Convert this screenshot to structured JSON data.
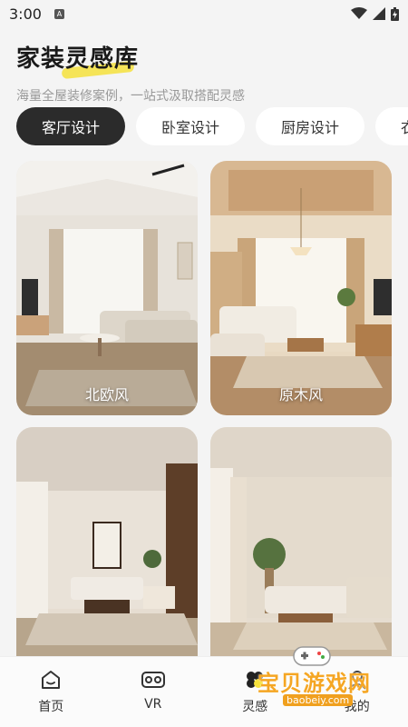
{
  "status": {
    "time": "3:00"
  },
  "header": {
    "title": "家装灵感库",
    "subtitle": "海量全屋装修案例，一站式汲取搭配灵感"
  },
  "tabs": [
    {
      "label": "客厅设计",
      "active": true
    },
    {
      "label": "卧室设计",
      "active": false
    },
    {
      "label": "厨房设计",
      "active": false
    },
    {
      "label": "衣",
      "active": false
    }
  ],
  "cards": [
    {
      "label": "北欧风"
    },
    {
      "label": "原木风"
    },
    {
      "label": ""
    },
    {
      "label": ""
    }
  ],
  "nav": [
    {
      "label": "首页",
      "icon": "home-icon"
    },
    {
      "label": "VR",
      "icon": "vr-icon"
    },
    {
      "label": "灵感",
      "icon": "inspiration-icon"
    },
    {
      "label": "我的",
      "icon": "profile-icon"
    }
  ],
  "watermark": {
    "text": "宝贝游戏网",
    "url": "baobeiy.com"
  },
  "colors": {
    "active_tab": "#2b2b2b",
    "accent": "#f5e13c",
    "watermark": "#f5a623"
  }
}
